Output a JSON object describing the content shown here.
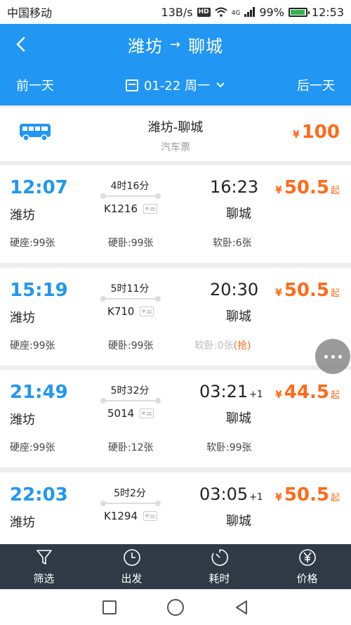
{
  "status_bar": {
    "carrier": "中国移动",
    "speed": "13B/s",
    "hd": "HD",
    "network": "4G",
    "battery": "99%",
    "time": "12:53"
  },
  "header": {
    "from": "潍坊",
    "arrow": "→",
    "to": "聊城",
    "prev_day": "前一天",
    "date": "01-22 周一",
    "next_day": "后一天"
  },
  "bus": {
    "title": "潍坊-聊城",
    "subtitle": "汽车票",
    "currency": "¥",
    "price": "100"
  },
  "trains": [
    {
      "dep_time": "12:07",
      "dep_station": "潍坊",
      "duration": "4时16分",
      "train_no": "K1216",
      "arr_time": "16:23",
      "arr_plus": "",
      "arr_station": "聊城",
      "currency": "¥",
      "price": "50.5",
      "qi": "起",
      "seat1": "硬座:99张",
      "seat2": "硬卧:99张",
      "seat3": "软卧:6张",
      "seat3_grab": ""
    },
    {
      "dep_time": "15:19",
      "dep_station": "潍坊",
      "duration": "5时11分",
      "train_no": "K710",
      "arr_time": "20:30",
      "arr_plus": "",
      "arr_station": "聊城",
      "currency": "¥",
      "price": "50.5",
      "qi": "起",
      "seat1": "硬座:99张",
      "seat2": "硬卧:99张",
      "seat3": "软卧:0张",
      "seat3_grab": "(抢)"
    },
    {
      "dep_time": "21:49",
      "dep_station": "潍坊",
      "duration": "5时32分",
      "train_no": "5014",
      "arr_time": "03:21",
      "arr_plus": "+1",
      "arr_station": "聊城",
      "currency": "¥",
      "price": "44.5",
      "qi": "起",
      "seat1": "硬座:99张",
      "seat2": "硬卧:12张",
      "seat3": "软卧:99张",
      "seat3_grab": ""
    },
    {
      "dep_time": "22:03",
      "dep_station": "潍坊",
      "duration": "5时2分",
      "train_no": "K1294",
      "arr_time": "03:05",
      "arr_plus": "+1",
      "arr_station": "聊城",
      "currency": "¥",
      "price": "50.5",
      "qi": "起",
      "seat1": "",
      "seat2": "",
      "seat3": "",
      "seat3_grab": ""
    }
  ],
  "tabs": [
    {
      "label": "筛选",
      "icon": "filter-icon"
    },
    {
      "label": "出发",
      "icon": "clock-icon"
    },
    {
      "label": "耗时",
      "icon": "timer-icon"
    },
    {
      "label": "价格",
      "icon": "yen-icon"
    }
  ],
  "colors": {
    "primary": "#2196f3",
    "price": "#ff6a1a",
    "tabbar": "#2f3a46"
  }
}
